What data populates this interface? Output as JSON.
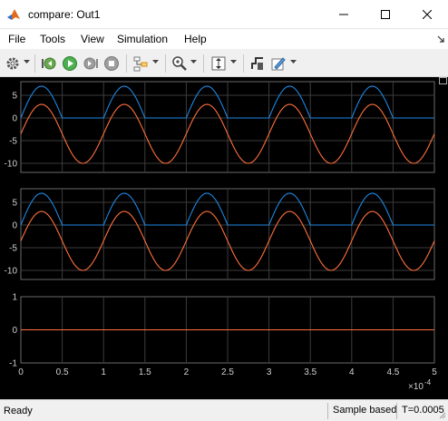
{
  "window": {
    "title": "compare: Out1"
  },
  "menu": [
    "File",
    "Tools",
    "View",
    "Simulation",
    "Help"
  ],
  "toolbar": {
    "icons": [
      "gear-icon",
      "step-back-icon",
      "run-icon",
      "stop-icon",
      "signal-trace-icon",
      "zoom-icon",
      "autoscale-icon",
      "triggers-icon",
      "style-icon"
    ]
  },
  "colors": {
    "series1": "#1e88e5",
    "series2": "#ff6f3c",
    "background": "#000000",
    "grid": "#3c3c3c"
  },
  "chart_data": [
    {
      "type": "line",
      "ylim": [
        -12,
        8
      ],
      "yticks": [
        "5",
        "0",
        "-5",
        "-10"
      ],
      "xlim": [
        0,
        5
      ],
      "series": [
        {
          "kind": "half-wave-positive",
          "amplitude": 7,
          "periods": 5,
          "color": "#1e88e5"
        },
        {
          "kind": "sine-offset",
          "offset": -3.5,
          "amplitude": 6.5,
          "periods": 5,
          "color": "#ff6f3c"
        }
      ]
    },
    {
      "type": "line",
      "ylim": [
        -12,
        8
      ],
      "yticks": [
        "5",
        "0",
        "-5",
        "-10"
      ],
      "xlim": [
        0,
        5
      ],
      "series": [
        {
          "kind": "half-wave-positive",
          "amplitude": 7,
          "periods": 5,
          "color": "#1e88e5"
        },
        {
          "kind": "sine-offset",
          "offset": -3.5,
          "amplitude": 6.5,
          "periods": 5,
          "color": "#ff6f3c"
        }
      ]
    },
    {
      "type": "line",
      "ylim": [
        -1,
        1
      ],
      "yticks": [
        "1",
        "0",
        "-1"
      ],
      "xlim": [
        0,
        5
      ],
      "xticks": [
        "0",
        "0.5",
        "1",
        "1.5",
        "2",
        "2.5",
        "3",
        "3.5",
        "4",
        "4.5",
        "5"
      ],
      "xscale_label": "×10",
      "xscale_exp": "-4",
      "series": [
        {
          "kind": "zero",
          "color": "#ff6f3c"
        }
      ]
    }
  ],
  "status": {
    "ready": "Ready",
    "mode": "Sample based",
    "time": "T=0.0005"
  }
}
